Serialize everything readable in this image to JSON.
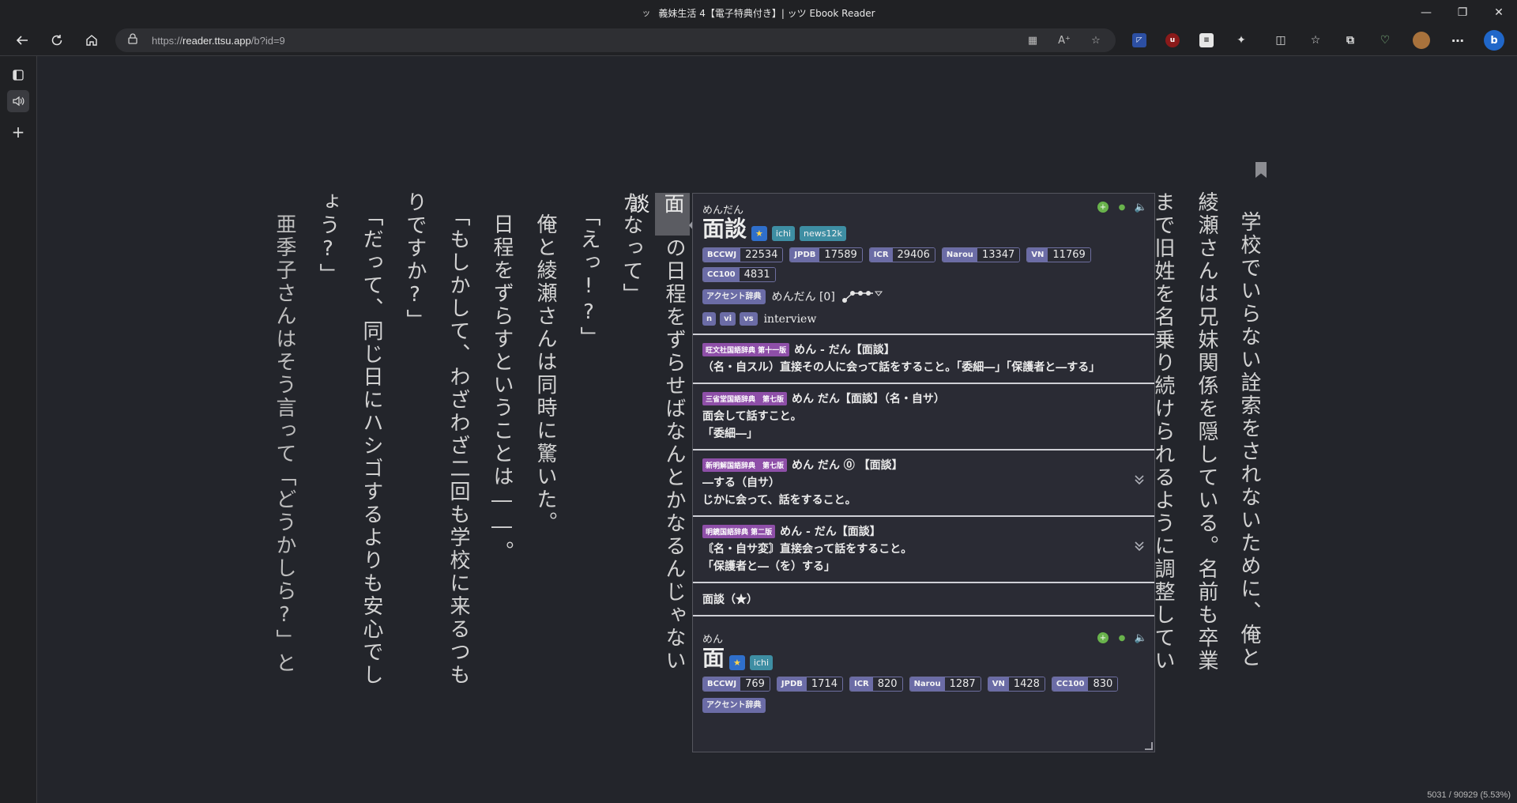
{
  "window": {
    "title": "義妹生活 4【電子特典付き】| ッツ Ebook Reader",
    "favicon": "ッ"
  },
  "address": {
    "url_prefix": "https://",
    "url_host": "reader.ttsu.app",
    "url_path": "/b?id=9"
  },
  "reader": {
    "lines": [
      "学校でいらない詮索をされないために、俺と",
      "綾瀬さんは兄妹関係を隠している。名前も卒業",
      "まで旧姓を名乗り続けられるように調整してい",
      "の日程をずらせばなんとかなるんじゃない",
      "かなって」",
      "「えっ!?」",
      "俺と綾瀬さんは同時に驚いた。",
      "日程をずらすということは――。",
      "「もしかして、わざわざ二回も学校に来るつも",
      "りですか?」",
      "「だって、同じ日にハシゴするよりも安心でし",
      "ょう?」",
      "亜季子さんはそう言って「どうかしら?」と"
    ],
    "highlighted": "面談",
    "progress": "5031 / 90929 (5.53%)"
  },
  "popup": {
    "entry1": {
      "reading": "めんだん",
      "headword": "面談",
      "tags": [
        "★",
        "ichi",
        "news12k"
      ],
      "freqs": [
        {
          "k": "BCCWJ",
          "v": "22534"
        },
        {
          "k": "JPDB",
          "v": "17589"
        },
        {
          "k": "ICR",
          "v": "29406"
        },
        {
          "k": "Narou",
          "v": "13347"
        },
        {
          "k": "VN",
          "v": "11769"
        },
        {
          "k": "CC100",
          "v": "4831"
        }
      ],
      "accent_label": "アクセント辞典",
      "pitch": "めんだん [0]",
      "pos": [
        "n",
        "vi",
        "vs"
      ],
      "gloss": "interview"
    },
    "defs": [
      {
        "dict": "旺文社国語辞典 第十一版",
        "head": "めん - だん【面談】",
        "body": [
          "（名・自スル）直接その人に会って話をすること。「委細―」「保護者と―する」"
        ],
        "chevron": false
      },
      {
        "dict": "三省堂国語辞典　第七版",
        "head": "めん だん【面談】（名・自サ）",
        "body": [
          "面会して話すこと。",
          "「委細―」"
        ],
        "chevron": false
      },
      {
        "dict": "新明解国語辞典　第七版",
        "head": "めん だん ⓪ 【面談】",
        "body": [
          "―する（自サ）",
          "じかに会って、話をすること。"
        ],
        "chevron": true
      },
      {
        "dict": "明鏡国語辞典 第二版",
        "head": "めん - だん【面談】",
        "body": [
          "〘名・自サ変〙直接会って話をすること。",
          "「保護者と―（を）する」"
        ],
        "chevron": true
      }
    ],
    "kanji_line": "面談（★）",
    "entry2": {
      "reading": "めん",
      "headword": "面",
      "tags": [
        "★",
        "ichi"
      ],
      "freqs": [
        {
          "k": "BCCWJ",
          "v": "769"
        },
        {
          "k": "JPDB",
          "v": "1714"
        },
        {
          "k": "ICR",
          "v": "820"
        },
        {
          "k": "Narou",
          "v": "1287"
        },
        {
          "k": "VN",
          "v": "1428"
        },
        {
          "k": "CC100",
          "v": "830"
        }
      ],
      "accent_label": "アクセント辞典"
    }
  }
}
